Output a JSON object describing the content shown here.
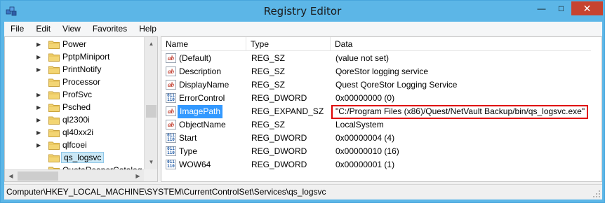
{
  "window": {
    "title": "Registry Editor",
    "min_symbol": "—",
    "max_symbol": "□",
    "close_symbol": "✕"
  },
  "menu": [
    "File",
    "Edit",
    "View",
    "Favorites",
    "Help"
  ],
  "tree": {
    "items": [
      {
        "label": "Power",
        "has_children": true,
        "selected": false
      },
      {
        "label": "PptpMiniport",
        "has_children": true,
        "selected": false
      },
      {
        "label": "PrintNotify",
        "has_children": true,
        "selected": false
      },
      {
        "label": "Processor",
        "has_children": false,
        "selected": false
      },
      {
        "label": "ProfSvc",
        "has_children": true,
        "selected": false
      },
      {
        "label": "Psched",
        "has_children": true,
        "selected": false
      },
      {
        "label": "ql2300i",
        "has_children": true,
        "selected": false
      },
      {
        "label": "ql40xx2i",
        "has_children": true,
        "selected": false
      },
      {
        "label": "qlfcoei",
        "has_children": true,
        "selected": false
      },
      {
        "label": "qs_logsvc",
        "has_children": false,
        "selected": true
      },
      {
        "label": "QuotaReaperCatalog",
        "has_children": false,
        "selected": false
      }
    ]
  },
  "list": {
    "columns": [
      "Name",
      "Type",
      "Data"
    ],
    "rows": [
      {
        "icon": "string-value-icon",
        "name": "(Default)",
        "type": "REG_SZ",
        "data": "(value not set)"
      },
      {
        "icon": "string-value-icon",
        "name": "Description",
        "type": "REG_SZ",
        "data": "QoreStor logging service"
      },
      {
        "icon": "string-value-icon",
        "name": "DisplayName",
        "type": "REG_SZ",
        "data": "Quest QoreStor Logging Service"
      },
      {
        "icon": "dword-value-icon",
        "name": "ErrorControl",
        "type": "REG_DWORD",
        "data": "0x00000000 (0)"
      },
      {
        "icon": "string-value-icon",
        "name": "ImagePath",
        "type": "REG_EXPAND_SZ",
        "data": "\"C:/Program Files (x86)/Quest/NetVault Backup/bin/qs_logsvc.exe\""
      },
      {
        "icon": "string-value-icon",
        "name": "ObjectName",
        "type": "REG_SZ",
        "data": "LocalSystem"
      },
      {
        "icon": "dword-value-icon",
        "name": "Start",
        "type": "REG_DWORD",
        "data": "0x00000004 (4)"
      },
      {
        "icon": "dword-value-icon",
        "name": "Type",
        "type": "REG_DWORD",
        "data": "0x00000010 (16)"
      },
      {
        "icon": "dword-value-icon",
        "name": "WOW64",
        "type": "REG_DWORD",
        "data": "0x00000001 (1)"
      }
    ]
  },
  "status": {
    "path": "Computer\\HKEY_LOCAL_MACHINE\\SYSTEM\\CurrentControlSet\\Services\\qs_logsvc"
  },
  "colors": {
    "titlebar": "#5cb6e7",
    "selection": "#3399ff",
    "highlight_border": "#e00000",
    "close_button": "#c7432f"
  }
}
